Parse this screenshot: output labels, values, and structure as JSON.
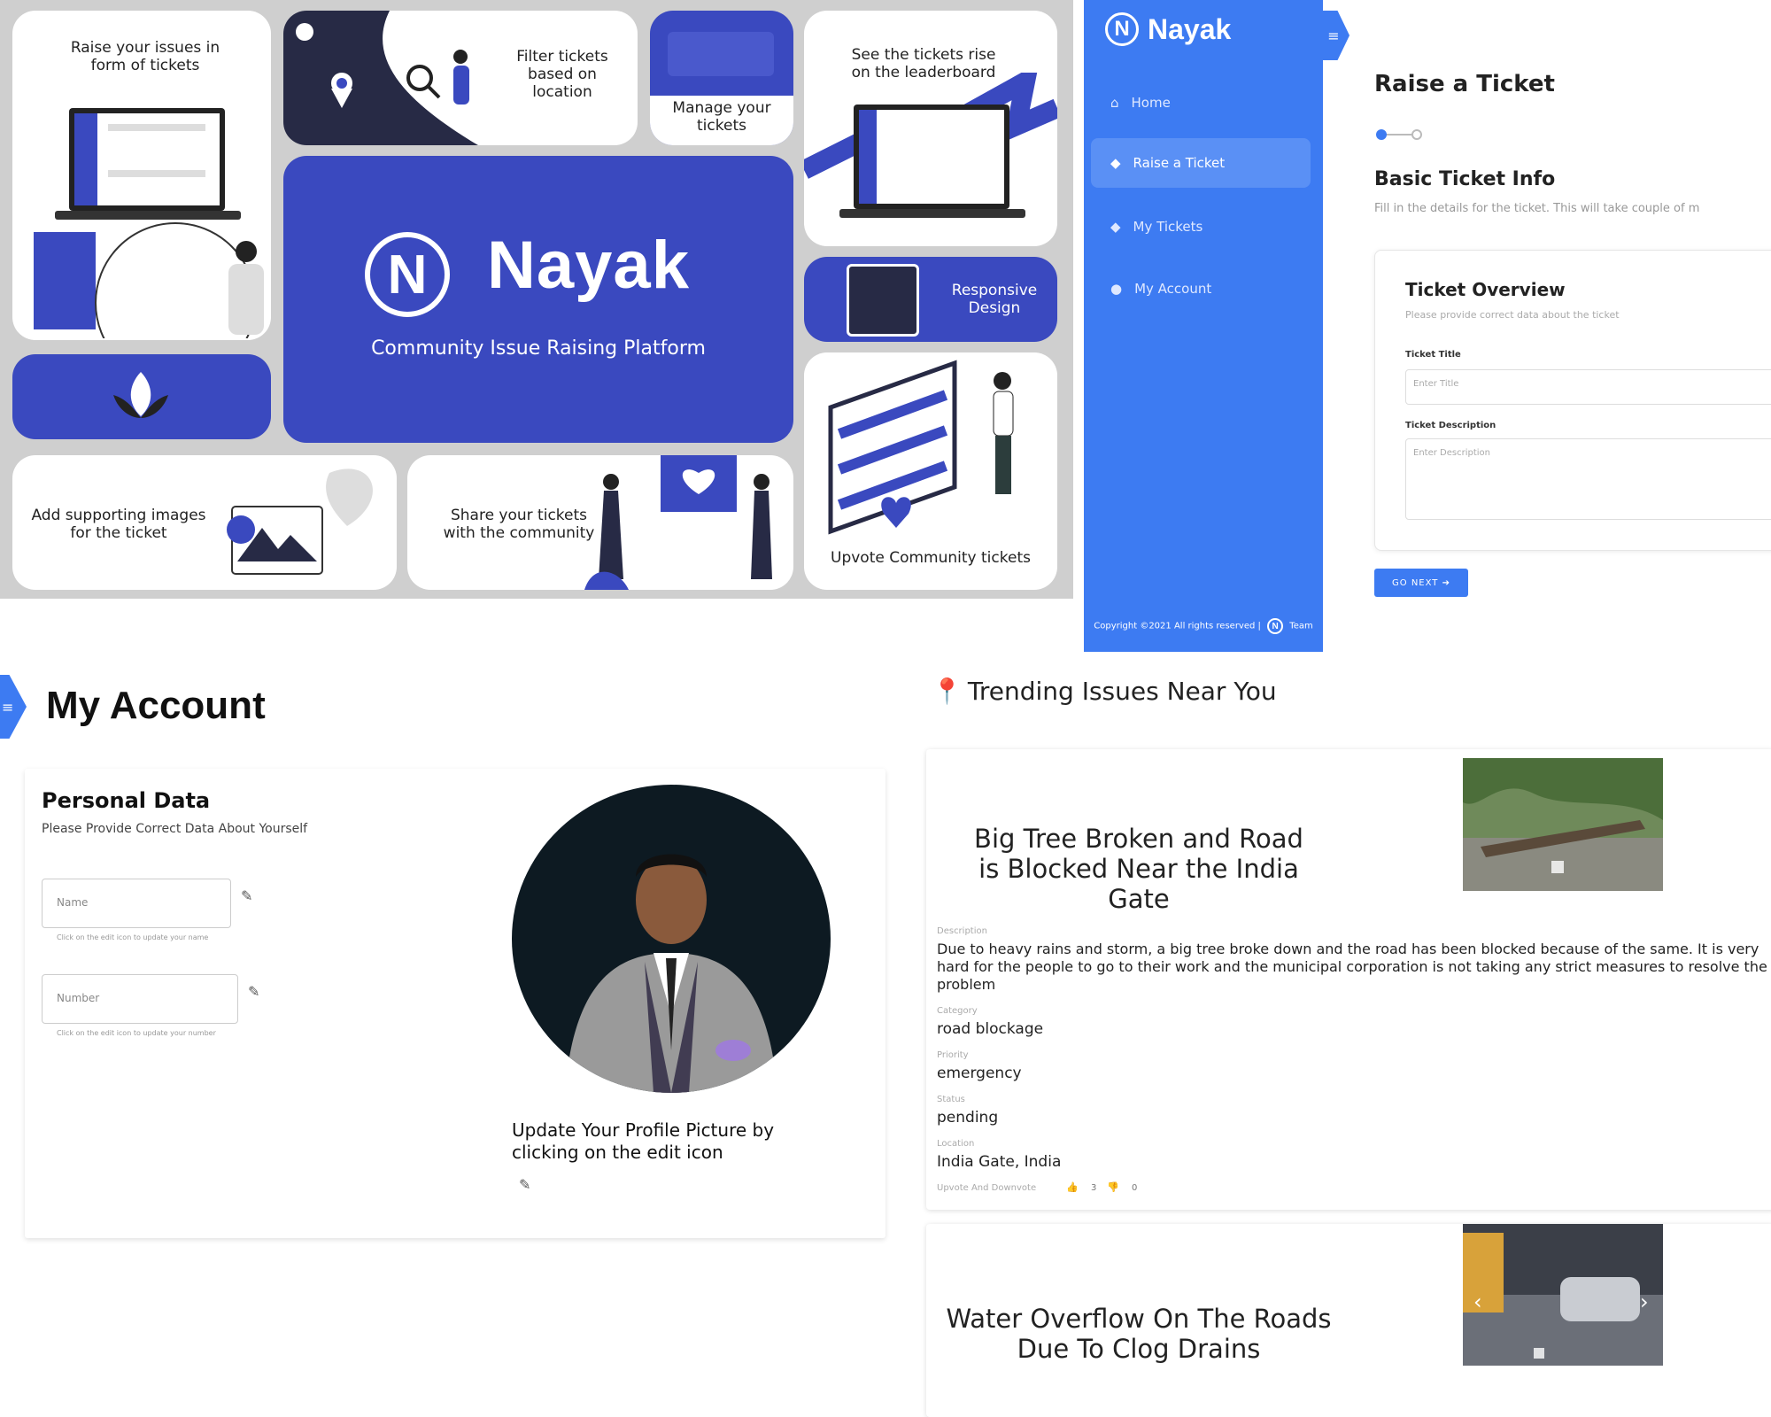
{
  "collage": {
    "tile_raise": "Raise your issues in form of tickets",
    "tile_filter": "Filter tickets based on location",
    "tile_manage": "Manage your tickets",
    "tile_leaderboard": "See the tickets rise on the leaderboard",
    "hero_brand": "Nayak",
    "hero_logo": "N",
    "hero_tagline": "Community Issue Raising Platform",
    "tile_responsive": "Responsive Design",
    "tile_images": "Add supporting images for the ticket",
    "tile_share": "Share your tickets with the community",
    "tile_upvote": "Upvote Community tickets"
  },
  "raise_ticket": {
    "brand": "Nayak",
    "logo": "N",
    "nav": [
      {
        "label": "Home",
        "icon": "home-icon"
      },
      {
        "label": "Raise a Ticket",
        "icon": "ticket-icon",
        "active": true
      },
      {
        "label": "My Tickets",
        "icon": "ticket-icon"
      },
      {
        "label": "My Account",
        "icon": "user-icon"
      }
    ],
    "copyright": "Copyright ©2021 All rights reserved |",
    "copyright_team": "Team",
    "title": "Raise a Ticket",
    "section_title": "Basic Ticket Info",
    "section_sub": "Fill in the details for the ticket. This will take couple of m",
    "card_title": "Ticket Overview",
    "card_sub": "Please provide correct data about the ticket",
    "title_label": "Ticket Title",
    "title_placeholder": "Enter Title",
    "desc_label": "Ticket Description",
    "desc_placeholder": "Enter Description",
    "next_button": "GO NEXT ➔"
  },
  "account": {
    "title": "My Account",
    "section_title": "Personal Data",
    "section_sub": "Please Provide Correct Data About Yourself",
    "name_placeholder": "Name",
    "name_hint": "Click on the edit icon to update your name",
    "number_placeholder": "Number",
    "number_hint": "Click on the edit icon to update your number",
    "picture_caption": "Update Your Profile Picture by clicking on the edit icon"
  },
  "trending": {
    "title": "Trending Issues Near You",
    "issues": [
      {
        "title": "Big Tree Broken and Road is Blocked Near the India Gate",
        "description_label": "Description",
        "description": "Due to heavy rains and storm, a big tree broke down and the road has been blocked because of the same. It is very hard for the people to go to their work and the municipal corporation is not taking any strict measures to resolve the problem",
        "category_label": "Category",
        "category": "road blockage",
        "priority_label": "Priority",
        "priority": "emergency",
        "status_label": "Status",
        "status": "pending",
        "location_label": "Location",
        "location": "India Gate, India",
        "votes_label": "Upvote And Downvote",
        "upvotes": "3",
        "downvotes": "0"
      },
      {
        "title": "Water Overflow On The Roads Due To Clog Drains"
      }
    ]
  },
  "colors": {
    "collage_blue": "#3a49bf",
    "collage_navy": "#272a45",
    "app_blue": "#3d7bf2"
  }
}
